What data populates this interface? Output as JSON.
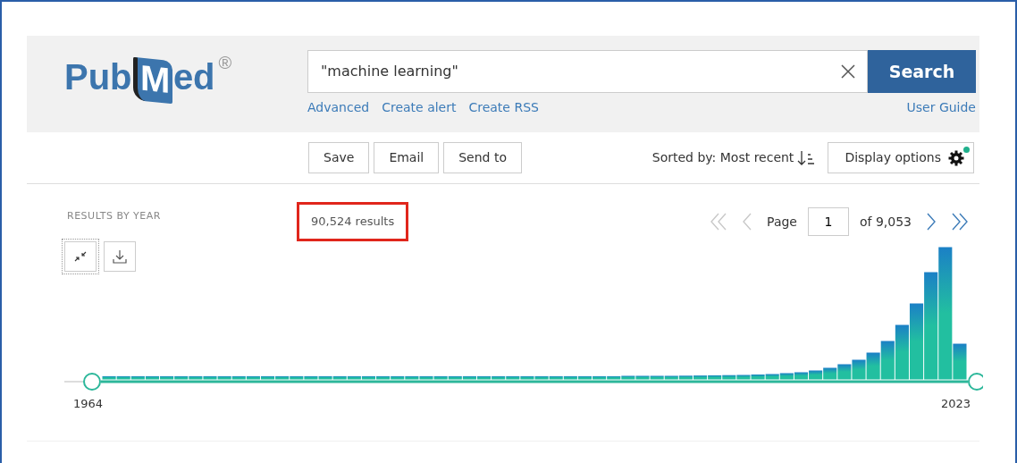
{
  "logo": {
    "prefix": "Pub",
    "boxed": "M",
    "suffix": "ed",
    "mark": "®"
  },
  "search": {
    "value": "\"machine learning\"",
    "button": "Search"
  },
  "search_links": [
    "Advanced",
    "Create alert",
    "Create RSS"
  ],
  "user_guide": "User Guide",
  "actions": [
    "Save",
    "Email",
    "Send to"
  ],
  "sort": {
    "label": "Sorted by: Most recent"
  },
  "display_options": {
    "label": "Display options",
    "modified": true
  },
  "results_by_year": {
    "title": "RESULTS BY YEAR",
    "start_year": "1964",
    "end_year": "2023"
  },
  "results_count": {
    "text": "90,524 results",
    "highlighted": true
  },
  "pagination": {
    "first_disabled": true,
    "prev_disabled": true,
    "page_label": "Page",
    "page": "1",
    "of": "of 9,053",
    "next_disabled": false,
    "last_disabled": false
  }
}
